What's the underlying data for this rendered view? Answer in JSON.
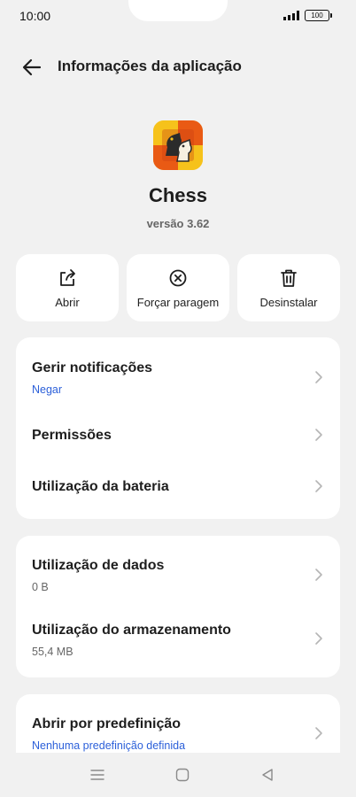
{
  "status": {
    "time": "10:00",
    "battery": "100"
  },
  "header": {
    "title": "Informações da aplicação"
  },
  "app": {
    "name": "Chess",
    "version": "versão 3.62"
  },
  "actions": [
    {
      "label": "Abrir",
      "icon": "open-external-icon"
    },
    {
      "label": "Forçar paragem",
      "icon": "close-circle-icon"
    },
    {
      "label": "Desinstalar",
      "icon": "trash-icon"
    }
  ],
  "sections": {
    "notifications": {
      "title": "Gerir notificações",
      "subtitle": "Negar"
    },
    "permissions": {
      "title": "Permissões"
    },
    "battery": {
      "title": "Utilização da bateria"
    },
    "data_usage": {
      "title": "Utilização de dados",
      "subtitle": "0 B"
    },
    "storage": {
      "title": "Utilização do armazenamento",
      "subtitle": "55,4 MB"
    },
    "default_open": {
      "title": "Abrir por predefinição",
      "subtitle": "Nenhuma predefinição definida"
    }
  },
  "colors": {
    "accent_link": "#2b5fd9",
    "background": "#f1f1f1",
    "card": "#ffffff"
  },
  "nav": [
    "menu-icon",
    "home-icon",
    "back-triangle-icon"
  ]
}
